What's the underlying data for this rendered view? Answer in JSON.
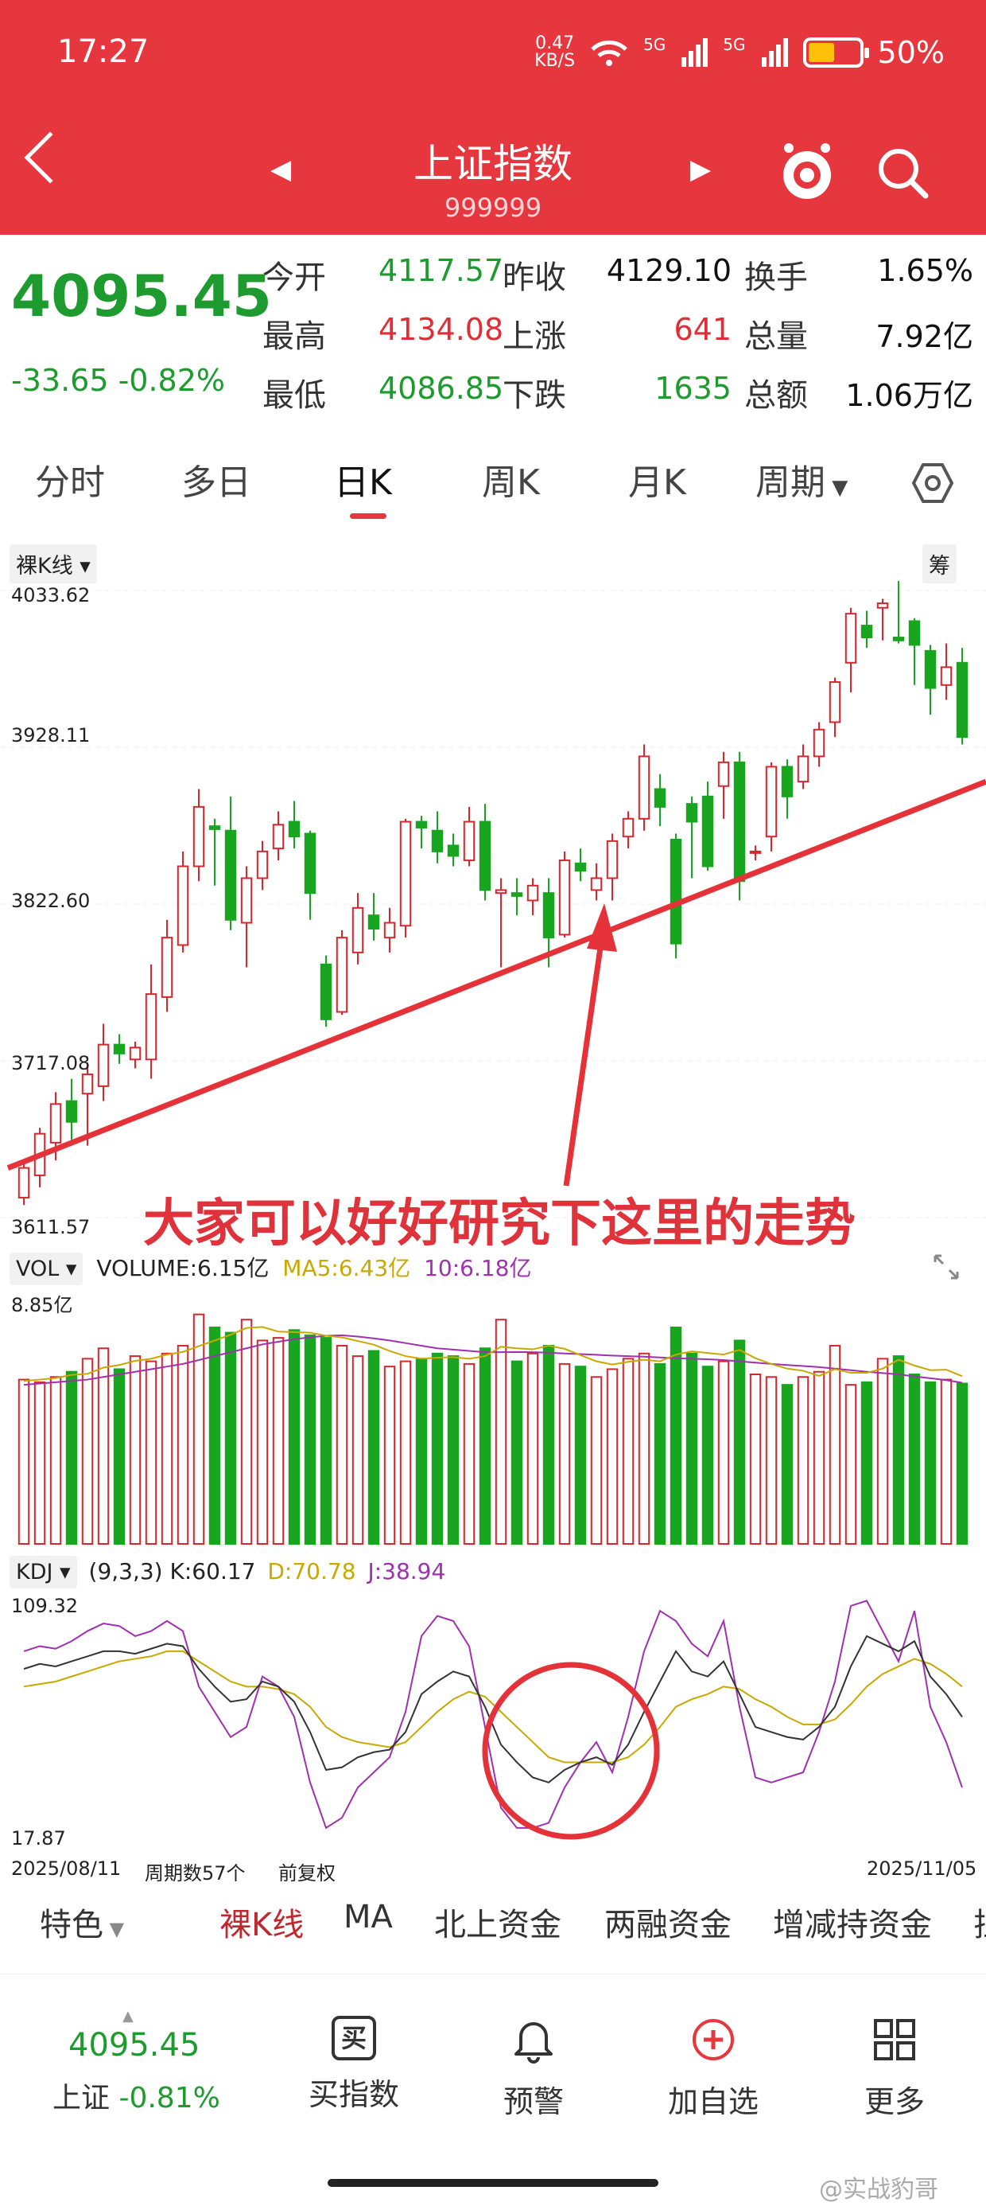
{
  "status": {
    "time": "17:27",
    "net_speed": "0.47",
    "net_unit": "KB/S",
    "sig1": "5G",
    "sig2": "5G",
    "battery": "50%",
    "battery_level": 0.5
  },
  "header": {
    "title": "上证指数",
    "code": "999999",
    "accent": "#e6373f"
  },
  "quote": {
    "price": "4095.45",
    "change": "-33.65",
    "change_pct": "-0.82%",
    "rows": [
      [
        {
          "label": "今开",
          "value": "4117.57",
          "color": "g"
        },
        {
          "label": "昨收",
          "value": "4129.10",
          "color": "k"
        },
        {
          "label": "换手",
          "value": "1.65%",
          "color": "k"
        }
      ],
      [
        {
          "label": "最高",
          "value": "4134.08",
          "color": "r"
        },
        {
          "label": "上涨",
          "value": "641",
          "color": "r"
        },
        {
          "label": "总量",
          "value": "7.92亿",
          "color": "k"
        }
      ],
      [
        {
          "label": "最低",
          "value": "4086.85",
          "color": "g"
        },
        {
          "label": "下跌",
          "value": "1635",
          "color": "g"
        },
        {
          "label": "总额",
          "value": "1.06万亿",
          "color": "k"
        }
      ]
    ]
  },
  "tabs": [
    "分时",
    "多日",
    "日K",
    "周K",
    "月K",
    "周期"
  ],
  "active_tab": "日K",
  "kline": {
    "tag": "裸K线",
    "right_tag": "筹",
    "y_labels": [
      "4033.62",
      "3928.11",
      "3822.60",
      "3717.08",
      "3611.57"
    ],
    "annotation": "大家可以好好研究下这里的走势"
  },
  "vol": {
    "tag": "VOL",
    "volume": "VOLUME:6.15亿",
    "ma5": "MA5:6.43亿",
    "ma10": "10:6.18亿",
    "max_label": "8.85亿"
  },
  "kdj": {
    "tag": "KDJ",
    "params": "(9,3,3)",
    "k": "K:60.17",
    "d": "D:70.78",
    "j": "J:38.94",
    "top": "109.32",
    "bottom": "17.87"
  },
  "footer_info": {
    "start": "2025/08/11",
    "count": "周期数57个",
    "adjust": "前复权",
    "end": "2025/11/05"
  },
  "indicators": [
    "特色",
    "裸K线",
    "MA",
    "北上资金",
    "两融资金",
    "增减持资金",
    "拉"
  ],
  "bottom": {
    "price": "4095.45",
    "name": "上证",
    "pct": "-0.81%",
    "buttons": [
      "买指数",
      "预警",
      "加自选",
      "更多"
    ],
    "buy_icon": "买"
  },
  "watermark": "@实战豹哥",
  "chart_data": {
    "type": "candlestick",
    "ylim": [
      3611.57,
      4033.62
    ],
    "candles": [
      [
        3625,
        3645,
        3620,
        3650
      ],
      [
        3640,
        3668,
        3632,
        3672
      ],
      [
        3662,
        3688,
        3650,
        3696
      ],
      [
        3690,
        3676,
        3660,
        3705
      ],
      [
        3695,
        3708,
        3660,
        3716
      ],
      [
        3700,
        3728,
        3690,
        3742
      ],
      [
        3728,
        3722,
        3715,
        3735
      ],
      [
        3718,
        3726,
        3712,
        3730
      ],
      [
        3718,
        3762,
        3705,
        3782
      ],
      [
        3760,
        3800,
        3750,
        3812
      ],
      [
        3795,
        3848,
        3790,
        3858
      ],
      [
        3848,
        3888,
        3838,
        3900
      ],
      [
        3875,
        3873,
        3835,
        3880
      ],
      [
        3872,
        3812,
        3805,
        3895
      ],
      [
        3810,
        3840,
        3780,
        3848
      ],
      [
        3840,
        3858,
        3832,
        3865
      ],
      [
        3860,
        3876,
        3852,
        3885
      ],
      [
        3878,
        3868,
        3860,
        3892
      ],
      [
        3870,
        3830,
        3812,
        3872
      ],
      [
        3782,
        3745,
        3740,
        3788
      ],
      [
        3750,
        3800,
        3748,
        3805
      ],
      [
        3790,
        3820,
        3782,
        3830
      ],
      [
        3815,
        3806,
        3798,
        3830
      ],
      [
        3800,
        3810,
        3790,
        3820
      ],
      [
        3808,
        3878,
        3800,
        3880
      ],
      [
        3878,
        3874,
        3860,
        3882
      ],
      [
        3872,
        3858,
        3850,
        3885
      ],
      [
        3862,
        3855,
        3848,
        3870
      ],
      [
        3852,
        3878,
        3848,
        3888
      ],
      [
        3878,
        3832,
        3825,
        3890
      ],
      [
        3830,
        3832,
        3780,
        3840
      ],
      [
        3830,
        3828,
        3815,
        3840
      ],
      [
        3825,
        3835,
        3815,
        3840
      ],
      [
        3830,
        3800,
        3780,
        3840
      ],
      [
        3802,
        3852,
        3800,
        3858
      ],
      [
        3850,
        3845,
        3838,
        3860
      ],
      [
        3832,
        3840,
        3825,
        3850
      ],
      [
        3840,
        3865,
        3825,
        3870
      ],
      [
        3868,
        3880,
        3860,
        3885
      ],
      [
        3880,
        3922,
        3872,
        3930
      ],
      [
        3900,
        3888,
        3875,
        3910
      ],
      [
        3866,
        3796,
        3786,
        3870
      ],
      [
        3890,
        3878,
        3840,
        3895
      ],
      [
        3895,
        3848,
        3845,
        3905
      ],
      [
        3902,
        3918,
        3880,
        3925
      ],
      [
        3918,
        3838,
        3825,
        3925
      ],
      [
        3858,
        3858,
        3852,
        3862
      ],
      [
        3868,
        3915,
        3858,
        3918
      ],
      [
        3915,
        3895,
        3880,
        3920
      ],
      [
        3905,
        3922,
        3900,
        3930
      ],
      [
        3922,
        3940,
        3915,
        3945
      ],
      [
        3945,
        3972,
        3935,
        3975
      ],
      [
        3985,
        4018,
        3965,
        4022
      ],
      [
        4010,
        4002,
        3995,
        4020
      ],
      [
        4022,
        4025,
        4000,
        4028
      ],
      [
        4002,
        4000,
        3998,
        4040
      ],
      [
        4013,
        3997,
        3970,
        4015
      ],
      [
        3993,
        3968,
        3950,
        3997
      ],
      [
        3970,
        3982,
        3960,
        3998
      ],
      [
        3985,
        3935,
        3930,
        3995
      ]
    ],
    "trendline": [
      [
        0,
        3645
      ],
      [
        59,
        3905
      ]
    ],
    "volume": {
      "ylim": [
        0,
        8.85
      ],
      "values": [
        6.3,
        6.2,
        6.4,
        6.6,
        7.1,
        7.5,
        6.7,
        7.2,
        7.0,
        7.3,
        7.6,
        8.8,
        8.3,
        8.1,
        8.6,
        7.8,
        7.9,
        8.2,
        8.0,
        7.9,
        7.6,
        7.2,
        7.4,
        6.8,
        7.0,
        7.1,
        7.3,
        7.2,
        6.9,
        7.5,
        8.6,
        7.0,
        7.3,
        7.6,
        6.9,
        6.8,
        6.4,
        6.7,
        7.1,
        7.3,
        6.9,
        8.3,
        7.3,
        6.8,
        7.0,
        7.8,
        6.5,
        6.4,
        6.1,
        6.4,
        6.6,
        7.6,
        6.1,
        6.2,
        7.1,
        7.2,
        6.5,
        6.2,
        6.3,
        6.15
      ],
      "ma5": [
        6.25,
        6.3,
        6.36,
        6.48,
        6.52,
        6.76,
        6.86,
        7.02,
        7.1,
        7.26,
        7.36,
        7.58,
        7.8,
        8.02,
        8.28,
        8.32,
        8.14,
        8.12,
        8.1,
        7.98,
        7.92,
        7.78,
        7.64,
        7.4,
        7.2,
        7.1,
        7.14,
        7.16,
        7.1,
        7.2,
        7.56,
        7.5,
        7.46,
        7.6,
        7.48,
        7.24,
        7.0,
        6.88,
        6.98,
        7.06,
        7.0,
        7.26,
        7.38,
        7.32,
        7.26,
        7.44,
        7.12,
        6.9,
        6.72,
        6.64,
        6.44,
        6.7,
        6.56,
        6.56,
        6.72,
        7.06,
        6.84,
        6.66,
        6.68,
        6.43
      ],
      "ma10": [
        6.1,
        6.15,
        6.2,
        6.25,
        6.3,
        6.4,
        6.5,
        6.6,
        6.7,
        6.8,
        6.9,
        7.05,
        7.2,
        7.35,
        7.5,
        7.65,
        7.75,
        7.85,
        7.92,
        7.98,
        8.0,
        7.95,
        7.88,
        7.8,
        7.7,
        7.6,
        7.5,
        7.45,
        7.4,
        7.35,
        7.35,
        7.36,
        7.35,
        7.33,
        7.3,
        7.28,
        7.25,
        7.22,
        7.2,
        7.18,
        7.15,
        7.12,
        7.1,
        7.08,
        7.05,
        7.0,
        6.95,
        6.9,
        6.86,
        6.82,
        6.78,
        6.72,
        6.66,
        6.6,
        6.55,
        6.5,
        6.42,
        6.35,
        6.28,
        6.18
      ]
    },
    "kdj": {
      "ylim": [
        17.87,
        109.32
      ],
      "k": [
        85,
        87,
        86,
        88,
        90,
        92,
        92,
        91,
        93,
        95,
        94,
        85,
        78,
        72,
        73,
        80,
        78,
        72,
        60,
        45,
        46,
        50,
        52,
        53,
        60,
        75,
        80,
        84,
        82,
        70,
        55,
        48,
        42,
        40,
        45,
        48,
        50,
        47,
        55,
        68,
        80,
        92,
        84,
        82,
        88,
        75,
        62,
        60,
        58,
        57,
        62,
        70,
        86,
        98,
        95,
        92,
        96,
        82,
        75,
        66
      ],
      "d": [
        78,
        79,
        80,
        82,
        84,
        86,
        88,
        89,
        90,
        92,
        92,
        88,
        84,
        80,
        78,
        78,
        77,
        75,
        70,
        62,
        58,
        56,
        55,
        54,
        56,
        62,
        68,
        73,
        76,
        74,
        68,
        62,
        56,
        50,
        48,
        48,
        48,
        48,
        50,
        55,
        62,
        70,
        73,
        75,
        78,
        77,
        73,
        70,
        66,
        63,
        63,
        65,
        71,
        78,
        83,
        86,
        89,
        87,
        83,
        78
      ],
      "j": [
        92,
        94,
        93,
        96,
        100,
        103,
        102,
        98,
        100,
        104,
        100,
        78,
        68,
        58,
        62,
        82,
        78,
        66,
        40,
        22,
        26,
        38,
        44,
        50,
        68,
        98,
        106,
        104,
        94,
        62,
        30,
        22,
        22,
        24,
        38,
        48,
        56,
        44,
        66,
        92,
        108,
        104,
        95,
        90,
        104,
        70,
        42,
        40,
        42,
        44,
        60,
        80,
        110,
        112,
        100,
        88,
        108,
        70,
        56,
        38
      ]
    }
  }
}
